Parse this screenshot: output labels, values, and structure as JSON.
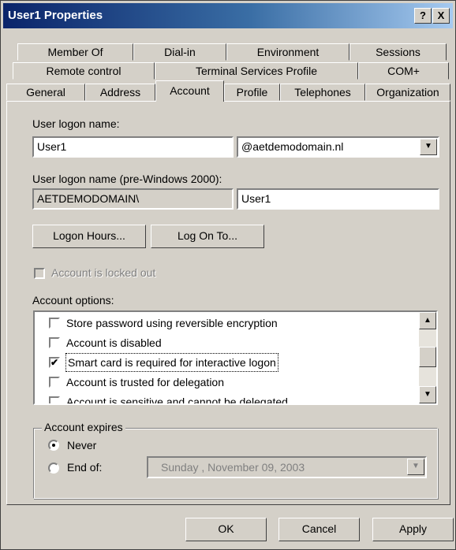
{
  "window": {
    "title": "User1 Properties",
    "help_label": "?",
    "close_label": "X"
  },
  "tabs_row1": [
    "Member Of",
    "Dial-in",
    "Environment",
    "Sessions"
  ],
  "tabs_row2": [
    "Remote control",
    "Terminal Services Profile",
    "COM+"
  ],
  "tabs_row3": [
    "General",
    "Address",
    "Account",
    "Profile",
    "Telephones",
    "Organization"
  ],
  "active_tab": "Account",
  "account": {
    "logon_name_label": "User logon name:",
    "logon_name_value": "User1",
    "domain_value": "@aetdemodomain.nl",
    "pre2000_label": "User logon name (pre-Windows 2000):",
    "pre2000_domain": "AETDEMODOMAIN\\",
    "pre2000_user": "User1",
    "logon_hours_button": "Logon Hours...",
    "log_on_to_button": "Log On To...",
    "locked_out_label": "Account is locked out",
    "options_label": "Account options:",
    "options": [
      {
        "label": "Store password using reversible encryption",
        "checked": false
      },
      {
        "label": "Account is disabled",
        "checked": false
      },
      {
        "label": "Smart card is required for interactive logon",
        "checked": true
      },
      {
        "label": "Account is trusted for delegation",
        "checked": false
      },
      {
        "label": "Account is sensitive and cannot be delegated",
        "checked": false
      }
    ],
    "expires_label": "Account expires",
    "never_label": "Never",
    "end_of_label": "End of:",
    "end_date": "Sunday    , November 09, 2003"
  },
  "buttons": {
    "ok": "OK",
    "cancel": "Cancel",
    "apply": "Apply"
  }
}
